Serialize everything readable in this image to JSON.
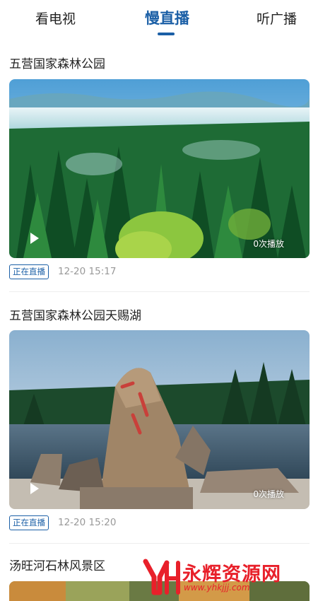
{
  "tabs": [
    {
      "label": "看电视"
    },
    {
      "label": "慢直播"
    },
    {
      "label": "听广播"
    }
  ],
  "active_tab_index": 1,
  "colors": {
    "accent": "#1b5fa6",
    "watermark": "#e8202a"
  },
  "cards": [
    {
      "title": "五营国家森林公园",
      "play_count": "0次播放",
      "status": "正在直播",
      "time": "12-20 15:17"
    },
    {
      "title": "五营国家森林公园天赐湖",
      "play_count": "0次播放",
      "status": "正在直播",
      "time": "12-20 15:20"
    },
    {
      "title": "汤旺河石林风景区"
    }
  ],
  "watermark": {
    "text": "永辉资源网",
    "url": "www.yhkjjj.com"
  }
}
